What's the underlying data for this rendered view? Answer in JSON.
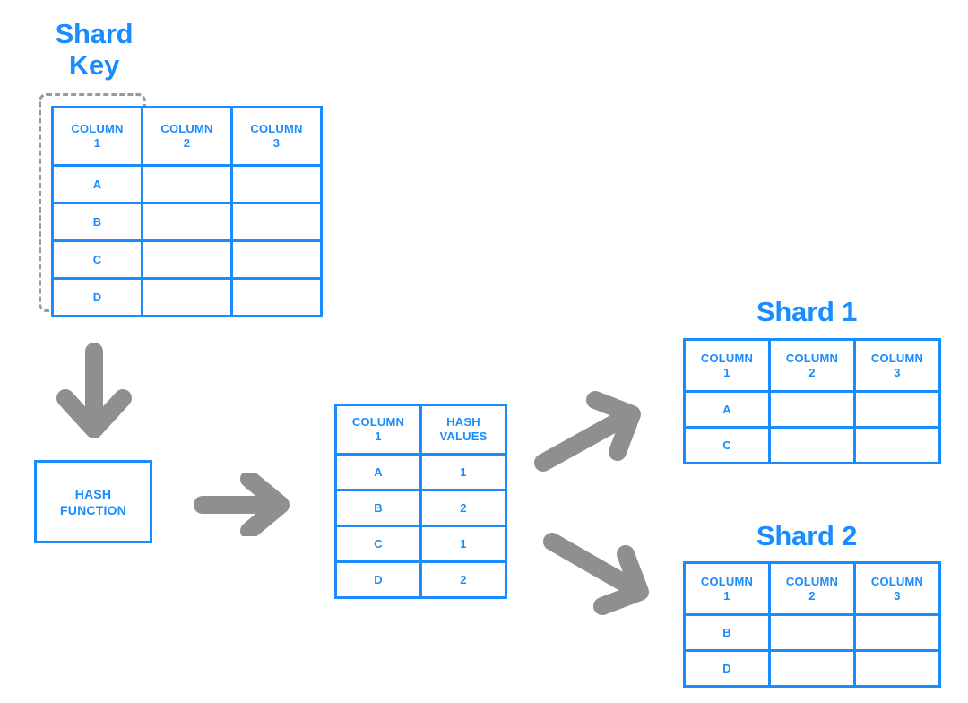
{
  "diagram": {
    "title_shard_key": "Shard\nKey",
    "title_shard1": "Shard 1",
    "title_shard2": "Shard 2",
    "hash_function_label": "HASH\nFUNCTION",
    "accent_color": "#1a8cfd",
    "arrow_color": "#8f8f8f",
    "selector_color": "#999999"
  },
  "main_table": {
    "headers": [
      "COLUMN\n1",
      "COLUMN\n2",
      "COLUMN\n3"
    ],
    "rows": [
      [
        "A",
        "",
        ""
      ],
      [
        "B",
        "",
        ""
      ],
      [
        "C",
        "",
        ""
      ],
      [
        "D",
        "",
        ""
      ]
    ]
  },
  "hash_table": {
    "headers": [
      "COLUMN\n1",
      "HASH\nVALUES"
    ],
    "rows": [
      [
        "A",
        "1"
      ],
      [
        "B",
        "2"
      ],
      [
        "C",
        "1"
      ],
      [
        "D",
        "2"
      ]
    ]
  },
  "shard1_table": {
    "headers": [
      "COLUMN\n1",
      "COLUMN\n2",
      "COLUMN\n3"
    ],
    "rows": [
      [
        "A",
        "",
        ""
      ],
      [
        "C",
        "",
        ""
      ]
    ]
  },
  "shard2_table": {
    "headers": [
      "COLUMN\n1",
      "COLUMN\n2",
      "COLUMN\n3"
    ],
    "rows": [
      [
        "B",
        "",
        ""
      ],
      [
        "D",
        "",
        ""
      ]
    ]
  },
  "arrows": [
    {
      "name": "arrow-down-to-hash",
      "direction": "down"
    },
    {
      "name": "arrow-right-to-hash-table",
      "direction": "right"
    },
    {
      "name": "arrow-up-right-to-shard1",
      "direction": "up-right"
    },
    {
      "name": "arrow-down-right-to-shard2",
      "direction": "down-right"
    }
  ]
}
